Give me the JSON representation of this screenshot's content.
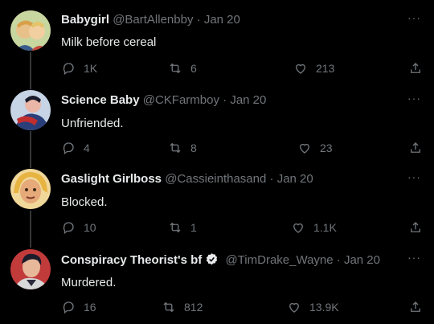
{
  "tweets": [
    {
      "name": "Babygirl",
      "handle": "@BartAllenbby",
      "date": "Jan 20",
      "text": "Milk before cereal",
      "replies": "1K",
      "retweets": "6",
      "likes": "213",
      "verified": false,
      "avatar_colors": [
        "#c8d6a0",
        "#e8c089",
        "#3a5b8c"
      ]
    },
    {
      "name": "Science Baby",
      "handle": "@CKFarmboy",
      "date": "Jan 20",
      "text": "Unfriended.",
      "replies": "4",
      "retweets": "8",
      "likes": "23",
      "verified": false,
      "avatar_colors": [
        "#c7d4e6",
        "#2a3f7a",
        "#e9b6a8"
      ]
    },
    {
      "name": "Gaslight Girlboss",
      "handle": "@Cassieinthasand",
      "date": "Jan 20",
      "text": "Blocked.",
      "replies": "10",
      "retweets": "1",
      "likes": "1.1K",
      "verified": false,
      "avatar_colors": [
        "#f0d79a",
        "#e6a97a",
        "#7b5a3a"
      ]
    },
    {
      "name": "Conspiracy Theorist's bf",
      "handle": "@TimDrake_Wayne",
      "date": "Jan 20",
      "text": "Murdered.",
      "replies": "16",
      "retweets": "812",
      "likes": "13.9K",
      "verified": true,
      "avatar_colors": [
        "#c23b3b",
        "#1c1c2b",
        "#e7b89a"
      ]
    }
  ],
  "icons": {
    "reply": "reply-icon",
    "retweet": "retweet-icon",
    "like": "heart-icon",
    "share": "share-icon",
    "more": "more-icon",
    "verified": "verified-badge-icon"
  },
  "more_label": "···",
  "dot_separator": "·",
  "colors": {
    "background": "#000000",
    "text": "#e7e9ea",
    "muted": "#71767b",
    "thread_line": "#333639"
  }
}
